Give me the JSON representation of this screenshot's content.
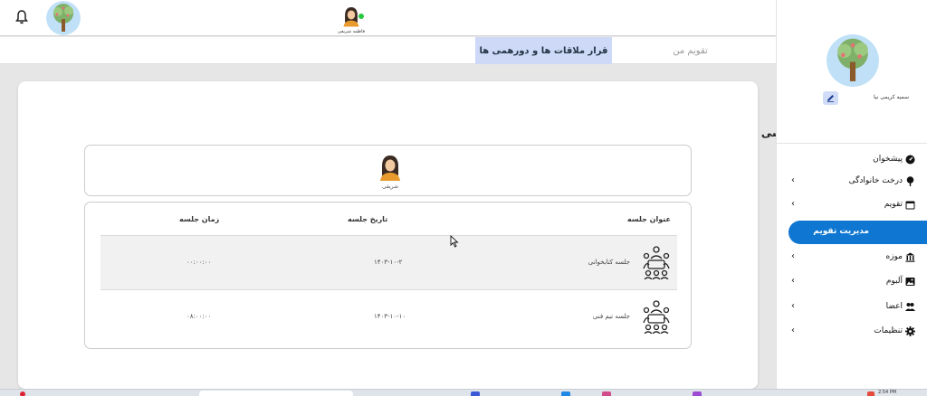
{
  "topbar": {
    "user_name": "فاطمه شریفی"
  },
  "tabs": [
    {
      "label": "قرار ملاقات ها و دورهمی ها",
      "active": true
    },
    {
      "label": "تقویم من",
      "active": false
    }
  ],
  "main": {
    "section_title": "تقویم اساسی",
    "member": {
      "name": "شریفی"
    },
    "table": {
      "headers": {
        "title": "عنوان جلسه",
        "date": "تاریخ جلسه",
        "time": "زمان جلسه"
      },
      "rows": [
        {
          "title": "جلسه کتابخوانی",
          "date": "۱۴۰۳-۱۰-۲",
          "time": "۰۰:۰۰:۰۰"
        },
        {
          "title": "جلسه تیم فنی",
          "date": "۱۴۰۳-۱۰-۱۰",
          "time": "۰۸:۰۰:۰۰"
        }
      ]
    }
  },
  "sidebar": {
    "user_name": "سمیه کریمی نیا",
    "items": [
      {
        "label": "پیشخوان",
        "icon": "dashboard-icon",
        "chevron": false
      },
      {
        "label": "درخت خانوادگی",
        "icon": "tree-icon",
        "chevron": true
      },
      {
        "label": "تقویم",
        "icon": "calendar-icon",
        "chevron": true
      },
      {
        "label": "مدیریت تقویم",
        "icon": "",
        "chevron": false,
        "active": true
      },
      {
        "label": "موزه",
        "icon": "museum-icon",
        "chevron": true
      },
      {
        "label": "آلبوم",
        "icon": "album-icon",
        "chevron": true
      },
      {
        "label": "اعضا",
        "icon": "members-icon",
        "chevron": true
      },
      {
        "label": "تنظیمات",
        "icon": "gear-icon",
        "chevron": true
      }
    ],
    "chevron_glyph": "‹"
  },
  "taskbar": {
    "left_text": "",
    "clock": "2:54 PM"
  },
  "colors": {
    "accent": "#0f77d1",
    "tab_active_bg": "#cdd9f6",
    "content_bg": "#e6e6e6",
    "online": "#27c93f"
  }
}
